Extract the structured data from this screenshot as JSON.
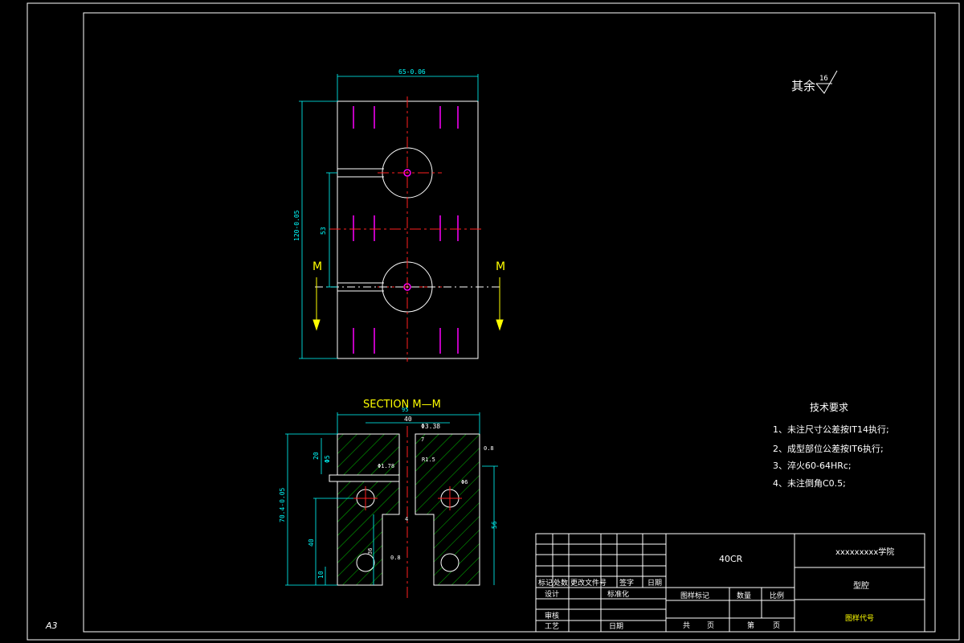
{
  "sheet": {
    "size_label": "A3"
  },
  "surface_finish": {
    "label": "其余",
    "value": "16"
  },
  "top_view": {
    "dim_width": "65-0.06",
    "dim_height": "120-0.05",
    "dim_hole_spacing": "53",
    "section_mark_left": "M",
    "section_mark_right": "M"
  },
  "section_view": {
    "title": "SECTION  M—M",
    "dim_top_width": "95",
    "dim_inner_width": "40",
    "dim_small_hole": "Φ3.38",
    "dim_slot": "7",
    "dim_20": "20",
    "dim_6": "Φ5",
    "dim_178": "Φ1.78",
    "dim_r15": "R1.5",
    "dim_phi6": "Φ6",
    "dim_height": "70.4-0.05",
    "dim_40": "40",
    "dim_10": "10",
    "dim_56": "56",
    "dim_36": "36",
    "dim_4": "4",
    "roughness_1": "0.8",
    "roughness_2": "0.8"
  },
  "tech_requirements": {
    "title": "技术要求",
    "items": [
      "1、未注尺寸公差按IT14执行;",
      "2、成型部位公差按IT6执行;",
      "3、淬火60-64HRc;",
      "4、未注倒角C0.5;"
    ]
  },
  "title_block": {
    "material": "40CR",
    "school": "xxxxxxxxx学院",
    "part_name": "型腔",
    "drawing_no": "图样代号",
    "headers": [
      "标记",
      "处数",
      "更改文件号",
      "签字",
      "日期"
    ],
    "design_label": "设计",
    "standard_label": "标准化",
    "review_label": "审核",
    "process_label": "工艺",
    "date_label": "日期",
    "stage_label": "图样标记",
    "qty_label": "数量",
    "scale_label": "比例",
    "total_label": "共",
    "page_label": "页",
    "sheet_label": "第",
    "sheet_page_label": "页"
  }
}
